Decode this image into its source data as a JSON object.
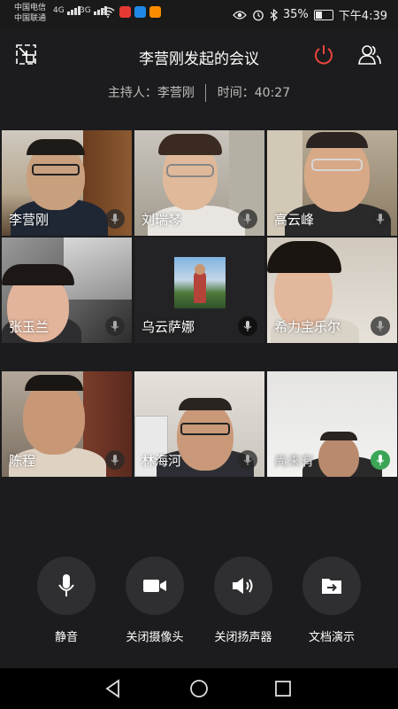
{
  "status_bar": {
    "carrier1": "中国电信",
    "carrier2": "中国联通",
    "net1": "4G",
    "net2": "3G",
    "battery": "35%",
    "time": "下午4:39"
  },
  "header": {
    "title": "李营刚发起的会议",
    "host_label": "主持人：",
    "host_name": "李营刚",
    "time_label": "时间：",
    "time_value": "40:27"
  },
  "participants": [
    {
      "name": "李营刚"
    },
    {
      "name": "刘瑞琴"
    },
    {
      "name": "高云峰"
    },
    {
      "name": "张玉兰"
    },
    {
      "name": "乌云萨娜"
    },
    {
      "name": "希力宝乐尔"
    },
    {
      "name": "陈程"
    },
    {
      "name": "林海河"
    },
    {
      "name": "尚来有"
    }
  ],
  "controls": {
    "mute": "静音",
    "camera_off": "关闭摄像头",
    "speaker_off": "关闭扬声器",
    "doc_share": "文档演示"
  },
  "colors": {
    "accent_red": "#e8453c",
    "mic_active": "#3aa655",
    "background": "#1c1c1e"
  }
}
